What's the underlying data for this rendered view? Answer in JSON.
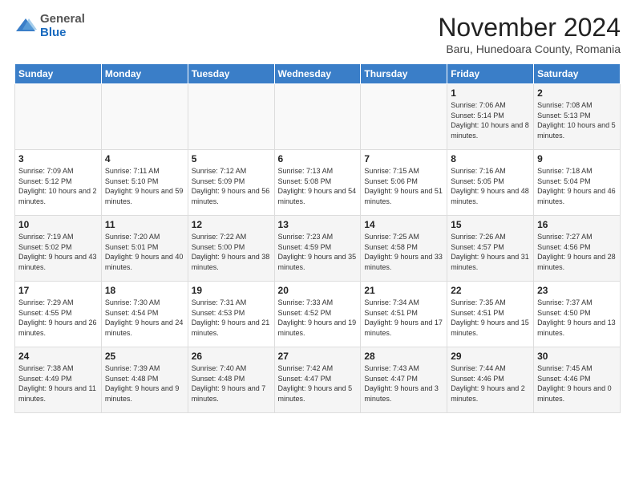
{
  "logo": {
    "general": "General",
    "blue": "Blue"
  },
  "header": {
    "month": "November 2024",
    "location": "Baru, Hunedoara County, Romania"
  },
  "weekdays": [
    "Sunday",
    "Monday",
    "Tuesday",
    "Wednesday",
    "Thursday",
    "Friday",
    "Saturday"
  ],
  "weeks": [
    [
      {
        "day": "",
        "info": ""
      },
      {
        "day": "",
        "info": ""
      },
      {
        "day": "",
        "info": ""
      },
      {
        "day": "",
        "info": ""
      },
      {
        "day": "",
        "info": ""
      },
      {
        "day": "1",
        "info": "Sunrise: 7:06 AM\nSunset: 5:14 PM\nDaylight: 10 hours and 8 minutes."
      },
      {
        "day": "2",
        "info": "Sunrise: 7:08 AM\nSunset: 5:13 PM\nDaylight: 10 hours and 5 minutes."
      }
    ],
    [
      {
        "day": "3",
        "info": "Sunrise: 7:09 AM\nSunset: 5:12 PM\nDaylight: 10 hours and 2 minutes."
      },
      {
        "day": "4",
        "info": "Sunrise: 7:11 AM\nSunset: 5:10 PM\nDaylight: 9 hours and 59 minutes."
      },
      {
        "day": "5",
        "info": "Sunrise: 7:12 AM\nSunset: 5:09 PM\nDaylight: 9 hours and 56 minutes."
      },
      {
        "day": "6",
        "info": "Sunrise: 7:13 AM\nSunset: 5:08 PM\nDaylight: 9 hours and 54 minutes."
      },
      {
        "day": "7",
        "info": "Sunrise: 7:15 AM\nSunset: 5:06 PM\nDaylight: 9 hours and 51 minutes."
      },
      {
        "day": "8",
        "info": "Sunrise: 7:16 AM\nSunset: 5:05 PM\nDaylight: 9 hours and 48 minutes."
      },
      {
        "day": "9",
        "info": "Sunrise: 7:18 AM\nSunset: 5:04 PM\nDaylight: 9 hours and 46 minutes."
      }
    ],
    [
      {
        "day": "10",
        "info": "Sunrise: 7:19 AM\nSunset: 5:02 PM\nDaylight: 9 hours and 43 minutes."
      },
      {
        "day": "11",
        "info": "Sunrise: 7:20 AM\nSunset: 5:01 PM\nDaylight: 9 hours and 40 minutes."
      },
      {
        "day": "12",
        "info": "Sunrise: 7:22 AM\nSunset: 5:00 PM\nDaylight: 9 hours and 38 minutes."
      },
      {
        "day": "13",
        "info": "Sunrise: 7:23 AM\nSunset: 4:59 PM\nDaylight: 9 hours and 35 minutes."
      },
      {
        "day": "14",
        "info": "Sunrise: 7:25 AM\nSunset: 4:58 PM\nDaylight: 9 hours and 33 minutes."
      },
      {
        "day": "15",
        "info": "Sunrise: 7:26 AM\nSunset: 4:57 PM\nDaylight: 9 hours and 31 minutes."
      },
      {
        "day": "16",
        "info": "Sunrise: 7:27 AM\nSunset: 4:56 PM\nDaylight: 9 hours and 28 minutes."
      }
    ],
    [
      {
        "day": "17",
        "info": "Sunrise: 7:29 AM\nSunset: 4:55 PM\nDaylight: 9 hours and 26 minutes."
      },
      {
        "day": "18",
        "info": "Sunrise: 7:30 AM\nSunset: 4:54 PM\nDaylight: 9 hours and 24 minutes."
      },
      {
        "day": "19",
        "info": "Sunrise: 7:31 AM\nSunset: 4:53 PM\nDaylight: 9 hours and 21 minutes."
      },
      {
        "day": "20",
        "info": "Sunrise: 7:33 AM\nSunset: 4:52 PM\nDaylight: 9 hours and 19 minutes."
      },
      {
        "day": "21",
        "info": "Sunrise: 7:34 AM\nSunset: 4:51 PM\nDaylight: 9 hours and 17 minutes."
      },
      {
        "day": "22",
        "info": "Sunrise: 7:35 AM\nSunset: 4:51 PM\nDaylight: 9 hours and 15 minutes."
      },
      {
        "day": "23",
        "info": "Sunrise: 7:37 AM\nSunset: 4:50 PM\nDaylight: 9 hours and 13 minutes."
      }
    ],
    [
      {
        "day": "24",
        "info": "Sunrise: 7:38 AM\nSunset: 4:49 PM\nDaylight: 9 hours and 11 minutes."
      },
      {
        "day": "25",
        "info": "Sunrise: 7:39 AM\nSunset: 4:48 PM\nDaylight: 9 hours and 9 minutes."
      },
      {
        "day": "26",
        "info": "Sunrise: 7:40 AM\nSunset: 4:48 PM\nDaylight: 9 hours and 7 minutes."
      },
      {
        "day": "27",
        "info": "Sunrise: 7:42 AM\nSunset: 4:47 PM\nDaylight: 9 hours and 5 minutes."
      },
      {
        "day": "28",
        "info": "Sunrise: 7:43 AM\nSunset: 4:47 PM\nDaylight: 9 hours and 3 minutes."
      },
      {
        "day": "29",
        "info": "Sunrise: 7:44 AM\nSunset: 4:46 PM\nDaylight: 9 hours and 2 minutes."
      },
      {
        "day": "30",
        "info": "Sunrise: 7:45 AM\nSunset: 4:46 PM\nDaylight: 9 hours and 0 minutes."
      }
    ]
  ]
}
